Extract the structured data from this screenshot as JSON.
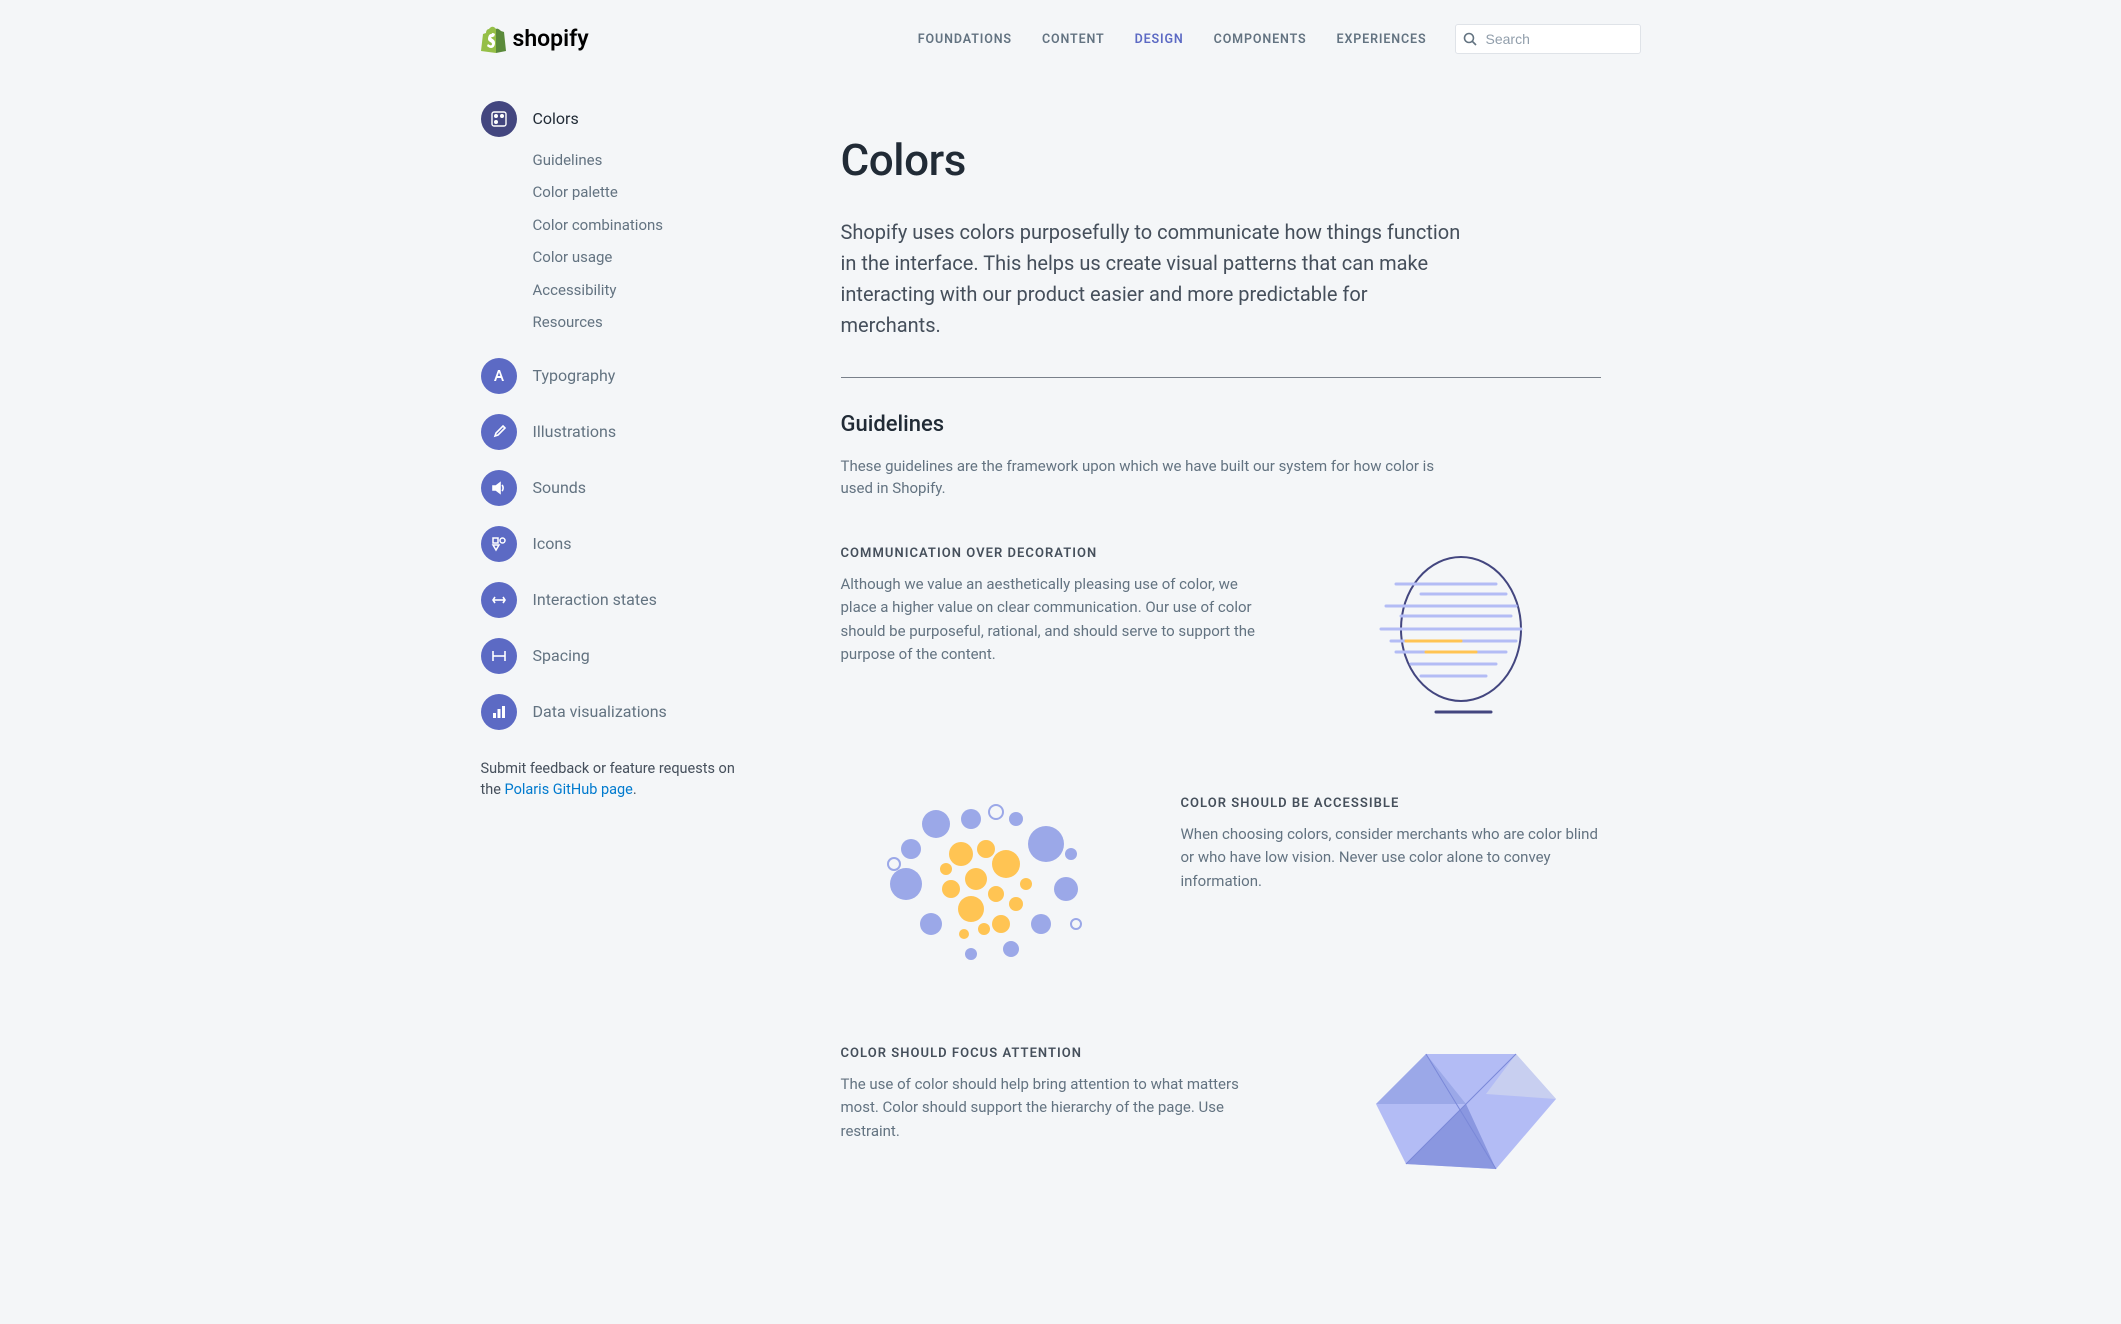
{
  "brand": "shopify",
  "nav": {
    "tabs": [
      "FOUNDATIONS",
      "CONTENT",
      "DESIGN",
      "COMPONENTS",
      "EXPERIENCES"
    ],
    "active": 2,
    "search_placeholder": "Search"
  },
  "sidebar": {
    "items": [
      {
        "label": "Colors"
      },
      {
        "label": "Typography"
      },
      {
        "label": "Illustrations"
      },
      {
        "label": "Sounds"
      },
      {
        "label": "Icons"
      },
      {
        "label": "Interaction states"
      },
      {
        "label": "Spacing"
      },
      {
        "label": "Data visualizations"
      }
    ],
    "sub": [
      "Guidelines",
      "Color palette",
      "Color combinations",
      "Color usage",
      "Accessibility",
      "Resources"
    ],
    "feedback_pre": "Submit feedback or feature requests on the ",
    "feedback_link": "Polaris GitHub page",
    "feedback_post": "."
  },
  "page": {
    "title": "Colors",
    "lead": "Shopify uses colors purposefully to communicate how things function in the interface. This helps us create visual patterns that can make interacting with our product easier and more predictable for merchants.",
    "guidelines_heading": "Guidelines",
    "guidelines_intro": "These guidelines are the framework upon which we have built our system for how color is used in Shopify.",
    "blocks": [
      {
        "eyebrow": "COMMUNICATION OVER DECORATION",
        "body": "Although we value an aesthetically pleasing use of color, we place a higher value on clear communication. Our use of color should be purposeful, rational, and should serve to support the purpose of the content."
      },
      {
        "eyebrow": "COLOR SHOULD BE ACCESSIBLE",
        "body": "When choosing colors, consider merchants who are color blind or who have low vision. Never use color alone to convey information."
      },
      {
        "eyebrow": "COLOR SHOULD FOCUS ATTENTION",
        "body": "The use of color should help bring attention to what matters most. Color should support the hierarchy of the page. Use restraint."
      }
    ]
  }
}
